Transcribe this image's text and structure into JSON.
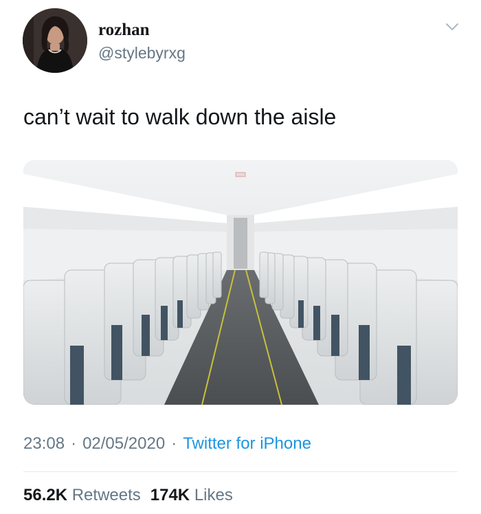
{
  "author": {
    "display_name": "rozhan",
    "handle": "@stylebyrxg"
  },
  "tweet": {
    "text": "can’t wait to walk down the aisle"
  },
  "media": {
    "sign_text": "EXIT"
  },
  "meta": {
    "time": "23:08",
    "separator": "·",
    "date": "02/05/2020",
    "source": "Twitter for iPhone"
  },
  "stats": {
    "retweets_count": "56.2K",
    "retweets_label": "Retweets",
    "likes_count": "174K",
    "likes_label": "Likes"
  },
  "icons": {
    "caret": "chevron-down-icon"
  },
  "colors": {
    "text": "#14171a",
    "secondary": "#657786",
    "link": "#1b95e0",
    "divider": "#e1e8ed"
  }
}
